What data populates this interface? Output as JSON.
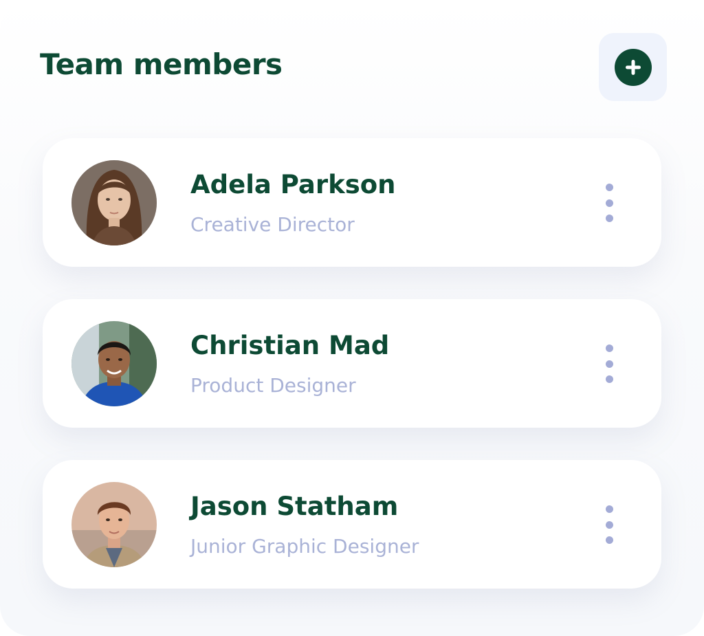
{
  "header": {
    "title": "Team members",
    "add_icon": "plus-circle-icon"
  },
  "colors": {
    "brand": "#0d4a34",
    "muted": "#a9b2d6",
    "button_bg": "#eff3fc"
  },
  "members": [
    {
      "name": "Adela Parkson",
      "role": "Creative Director",
      "menu_icon": "more-vertical-icon"
    },
    {
      "name": "Christian Mad",
      "role": "Product Designer",
      "menu_icon": "more-vertical-icon"
    },
    {
      "name": "Jason Statham",
      "role": "Junior Graphic Designer",
      "menu_icon": "more-vertical-icon"
    }
  ]
}
